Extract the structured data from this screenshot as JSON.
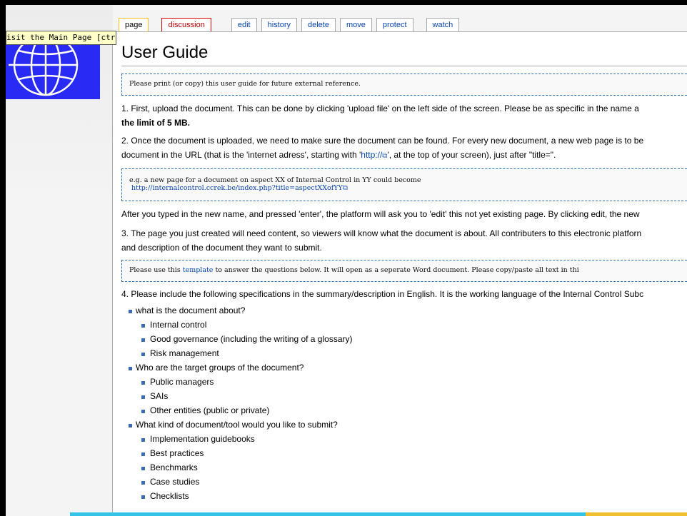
{
  "tooltip": "isit the Main Page [ctrl-alt-z]",
  "tabs": [
    {
      "label": "page"
    },
    {
      "label": "discussion"
    },
    {
      "label": "edit"
    },
    {
      "label": "history"
    },
    {
      "label": "delete"
    },
    {
      "label": "move"
    },
    {
      "label": "protect"
    },
    {
      "label": "watch"
    }
  ],
  "page": {
    "title": "User Guide",
    "box1": "Please print (or copy) this user guide for future external reference.",
    "p1_text": "1. First, upload the document. This can be done by clicking 'upload file' on the left side of the screen. Please be as specific in the name a",
    "p1_bold": "the limit of 5 MB.",
    "p2_line1": "2. Once the document is uploaded, we need to make sure the document can be found. For every new document, a new web page is to be",
    "p2_line2_pre": "document in the URL (that is the 'internet adress', starting with '",
    "p2_link": "http://",
    "p2_line2_post": "', at the top of your screen), just after \"title=\".",
    "box2_line1": "e.g. a new page for a document on aspect XX of Internal Control in YY could become",
    "box2_link": "http://internalcontrol.ccrek.be/index.php?title=aspectXXofYY",
    "p_after": "After you typed in the new name, and pressed 'enter', the platform will ask you to 'edit' this not yet existing page. By clicking edit, the new",
    "p3_line1": "3. The page you just created will need content, so viewers will know what the document is about. All contributers to this electronic platforn",
    "p3_line2": "and description of the document they want to submit.",
    "box3_pre": "Please use this ",
    "box3_link": "template",
    "box3_post": " to answer the questions below. It will open as a seperate Word document. Please copy/paste all text in thi",
    "p4": "4. Please include the following specifications in the summary/description in English. It is the working language of the Internal Control Subc"
  },
  "list": [
    {
      "level": 1,
      "text": "what is the document about?"
    },
    {
      "level": 2,
      "text": "Internal control"
    },
    {
      "level": 2,
      "text": "Good governance (including the writing of a glossary)"
    },
    {
      "level": 2,
      "text": "Risk management"
    },
    {
      "level": 1,
      "text": "Who are the target groups of the document?"
    },
    {
      "level": 2,
      "text": "Public managers"
    },
    {
      "level": 2,
      "text": "SAIs"
    },
    {
      "level": 2,
      "text": "Other entities (public or private)"
    },
    {
      "level": 1,
      "text": "What kind of document/tool would you like to submit?"
    },
    {
      "level": 2,
      "text": "Implementation guidebooks"
    },
    {
      "level": 2,
      "text": "Best practices"
    },
    {
      "level": 2,
      "text": "Benchmarks"
    },
    {
      "level": 2,
      "text": "Case studies"
    },
    {
      "level": 2,
      "text": "Checklists"
    }
  ],
  "icons": {
    "logo": "globe-logo-icon",
    "external": "external-link-icon"
  }
}
